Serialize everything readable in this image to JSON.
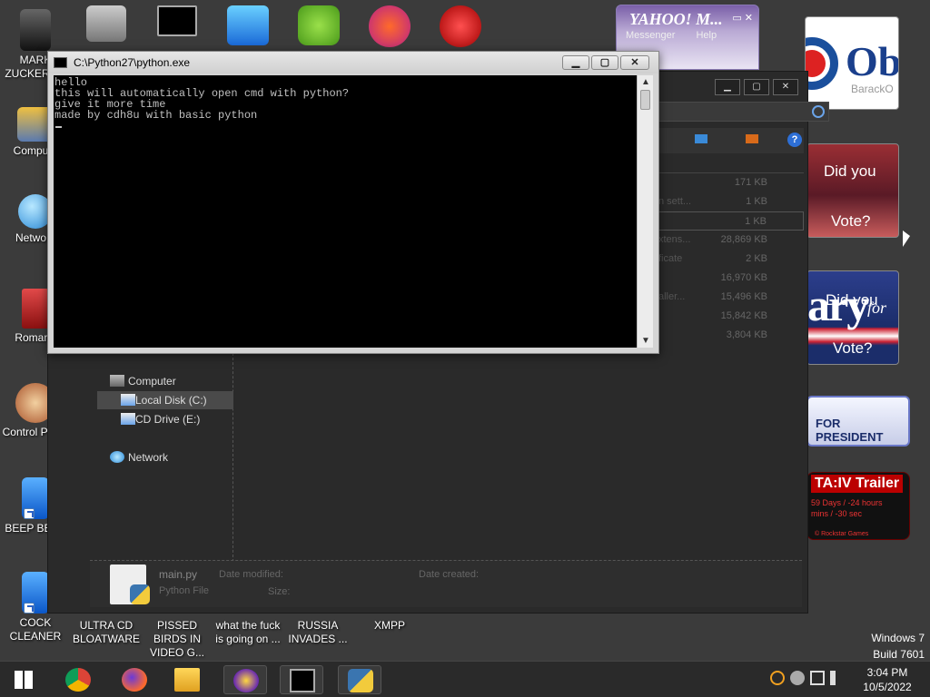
{
  "desktop": {
    "icons": [
      {
        "label": "MARK ZUCKERB..."
      },
      {
        "label": "Compu..."
      },
      {
        "label": "Netwo..."
      },
      {
        "label": "Romar..."
      },
      {
        "label": "Control Panel"
      },
      {
        "label": "BEEP BEEP"
      },
      {
        "label": "COCK CLEANER"
      },
      {
        "label": "ULTRA CD BLOATWARE"
      },
      {
        "label": "PISSED BIRDS IN VIDEO G..."
      },
      {
        "label": "what the fuck is going on ..."
      },
      {
        "label": "RUSSIA INVADES ..."
      },
      {
        "label": "XMPP"
      }
    ]
  },
  "gadgets": {
    "obama": {
      "logo_text": "Ob",
      "sub": "BarackO"
    },
    "vote1": {
      "line1": "Did you",
      "line2": "Vote?"
    },
    "vote2": {
      "big": "ary",
      "for": "for",
      "line1": "Did you",
      "line2": "Vote?"
    },
    "for_president": {
      "text": "FOR PRESIDENT"
    },
    "gta": {
      "title": "TA:IV Trailer",
      "count1": "59 Days / -24 hours",
      "count2": "mins / -30 sec",
      "footer": "© Rockstar Games"
    }
  },
  "yahoo": {
    "brand": "YAHOO! M...",
    "tab1": "Messenger",
    "tab2": "Help"
  },
  "console": {
    "title": "C:\\Python27\\python.exe",
    "output": "hello\nthis will automatically open cmd with python?\ngive it more time\nmade by cdh8u with basic python"
  },
  "explorer": {
    "list": [
      {
        "name": "",
        "size": "171 KB"
      },
      {
        "name": "n sett...",
        "size": "1 KB"
      },
      {
        "name": "",
        "size": "1 KB"
      },
      {
        "name": "xtens...",
        "size": "28,869 KB"
      },
      {
        "name": "ficate",
        "size": "2 KB"
      },
      {
        "name": "",
        "size": "16,970 KB"
      },
      {
        "name": "aller...",
        "size": "15,496 KB"
      },
      {
        "name": "",
        "size": "15,842 KB"
      },
      {
        "name": "",
        "size": "3,804 KB"
      }
    ],
    "nav": {
      "computer": "Computer",
      "local_disk": "Local Disk (C:)",
      "cd_drive": "CD Drive (E:)",
      "network": "Network"
    },
    "details": {
      "file_name": "main.py",
      "file_type": "Python File",
      "date_modified_label": "Date modified:",
      "date_created_label": "Date created:",
      "size_label": "Size:"
    }
  },
  "winver": {
    "line1": "Windows 7",
    "line2": "Build 7601"
  },
  "taskbar": {
    "time": "3:04 PM",
    "date": "10/5/2022"
  }
}
